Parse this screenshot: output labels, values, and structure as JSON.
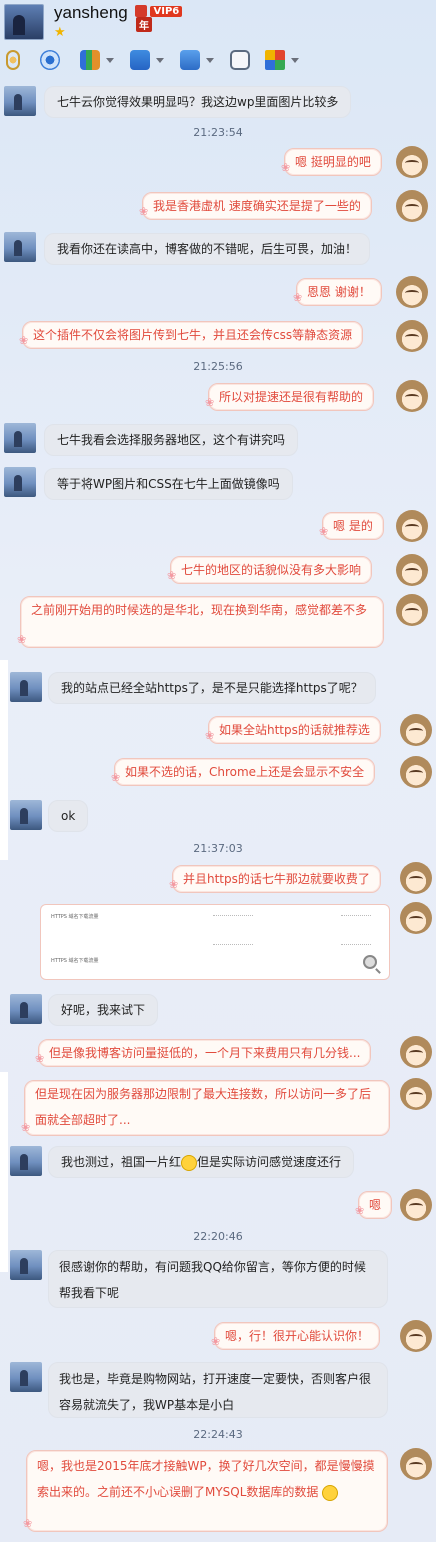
{
  "header": {
    "name": "yansheng",
    "vip_label": "VIP6",
    "year_label": "年",
    "star_icon": "star-icon"
  },
  "toolbar": {
    "icons": [
      "microphone-icon",
      "camera-icon",
      "screen-share-icon",
      "file-transfer-icon",
      "remote-desktop-icon",
      "add-app-icon",
      "apps-grid-icon"
    ]
  },
  "messages": {
    "m1": "七牛云你觉得效果明显吗？我这边wp里面图片比较多",
    "t1": "21:23:54",
    "m2": "嗯 挺明显的吧",
    "m3": "我是香港虚机 速度确实还是提了一些的",
    "m4": "我看你还在读高中，博客做的不错呢，后生可畏，加油！",
    "m5": "恩恩 谢谢！",
    "m6": "这个插件不仅会将图片传到七牛，并且还会传css等静态资源",
    "t2": "21:25:56",
    "m7": "所以对提速还是很有帮助的",
    "m8": "七牛我看会选择服务器地区，这个有讲究吗",
    "m9": "等于将WP图片和CSS在七牛上面做镜像吗",
    "m10": "嗯 是的",
    "m11": "七牛的地区的话貌似没有多大影响",
    "m12": "之前刚开始用的时候选的是华北，现在换到华南，感觉都差不多",
    "m13": "我的站点已经全站https了，是不是只能选择https了呢？",
    "m14": "如果全站https的话就推荐选",
    "m15": "如果不选的话，Chrome上还是会显示不安全",
    "m16": "ok",
    "t3": "21:37:03",
    "m17": "并且https的话七牛那边就要收费了",
    "m18": "好呢，我来试下",
    "m19": "但是像我博客访问量挺低的，一个月下来费用只有几分钱...",
    "m20": "但是现在因为服务器那边限制了最大连接数，所以访问一多了后面就全部超时了...",
    "m21a": "我也测过，祖国一片红",
    "m21b": "但是实际访问感觉速度还行",
    "m22": "嗯",
    "t4": "22:20:46",
    "m23": "很感谢你的帮助，有问题我QQ给你留言，等你方便的时候帮我看下呢",
    "m24": "嗯，行！很开心能认识你！",
    "m25": "我也是，毕竟是购物网站，打开速度一定要快，否则客户很容易就流失了，我WP基本是小白",
    "t5": "22:24:43",
    "m26": "嗯，我也是2015年底才接触WP，换了好几次空间，都是慢慢摸索出来的。之前还不小心误删了MYSQL数据库的数据"
  },
  "image_card": {
    "row1": "HTTPS 域名下载流量",
    "row2": "HTTPS 域名下载流量"
  },
  "colors": {
    "accent_red": "#e14a3c",
    "bubble_left": "#e6e9ef",
    "bubble_right": "#fffaf6"
  }
}
